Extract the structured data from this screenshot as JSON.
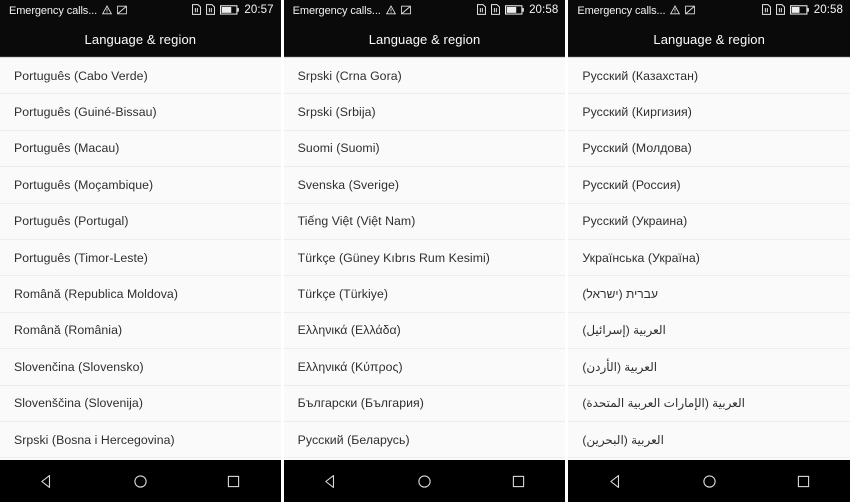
{
  "screens": [
    {
      "status_bar": {
        "carrier": "Emergency calls...",
        "icons": [
          "warning-triangle-icon",
          "image-broken-icon"
        ],
        "right_icons": [
          "sim1-signal-icon",
          "sim2-signal-icon",
          "battery-icon"
        ],
        "clock": "20:57"
      },
      "title": "Language & region",
      "rows": [
        "Português (Cabo Verde)",
        "Português (Guiné-Bissau)",
        "Português (Macau)",
        "Português (Moçambique)",
        "Português (Portugal)",
        "Português (Timor-Leste)",
        "Română (Republica Moldova)",
        "Română (România)",
        "Slovenčina (Slovensko)",
        "Slovenščina (Slovenija)",
        "Srpski (Bosna i Hercegovina)"
      ],
      "rtl": false,
      "nav": [
        "back-icon",
        "home-icon",
        "recents-icon"
      ]
    },
    {
      "status_bar": {
        "carrier": "Emergency calls...",
        "icons": [
          "warning-triangle-icon",
          "image-broken-icon"
        ],
        "right_icons": [
          "sim1-signal-icon",
          "sim2-signal-icon",
          "battery-icon"
        ],
        "clock": "20:58"
      },
      "title": "Language & region",
      "rows": [
        "Srpski (Crna Gora)",
        "Srpski (Srbija)",
        "Suomi (Suomi)",
        "Svenska (Sverige)",
        "Tiếng Việt (Việt Nam)",
        "Türkçe (Güney Kıbrıs Rum Kesimi)",
        "Türkçe (Türkiye)",
        "Ελληνικά (Ελλάδα)",
        "Ελληνικά (Κύπρος)",
        "Български (България)",
        "Русский (Беларусь)"
      ],
      "rtl": false,
      "nav": [
        "back-icon",
        "home-icon",
        "recents-icon"
      ]
    },
    {
      "status_bar": {
        "carrier": "Emergency calls...",
        "icons": [
          "warning-triangle-icon",
          "image-broken-icon"
        ],
        "right_icons": [
          "sim1-signal-icon",
          "sim2-signal-icon",
          "battery-icon"
        ],
        "clock": "20:58"
      },
      "title": "Language & region",
      "rows": [
        "Русский (Казахстан)",
        "Русский (Киргизия)",
        "Русский (Молдова)",
        "Русский (Россия)",
        "Русский (Украина)",
        "Українська (Україна)",
        "עברית (ישראל)",
        "العربية (إسرائيل)",
        "العربية (الأردن)",
        "العربية (الإمارات العربية المتحدة)",
        "العربية (البحرين)"
      ],
      "rtl_from_index": 6,
      "nav": [
        "back-icon",
        "home-icon",
        "recents-icon"
      ]
    }
  ],
  "colors": {
    "status_bg": "#0a0a0a",
    "list_bg": "#fafafa",
    "text": "#2e2e30",
    "separator": "#ededf0",
    "nav_bg": "#000000"
  }
}
